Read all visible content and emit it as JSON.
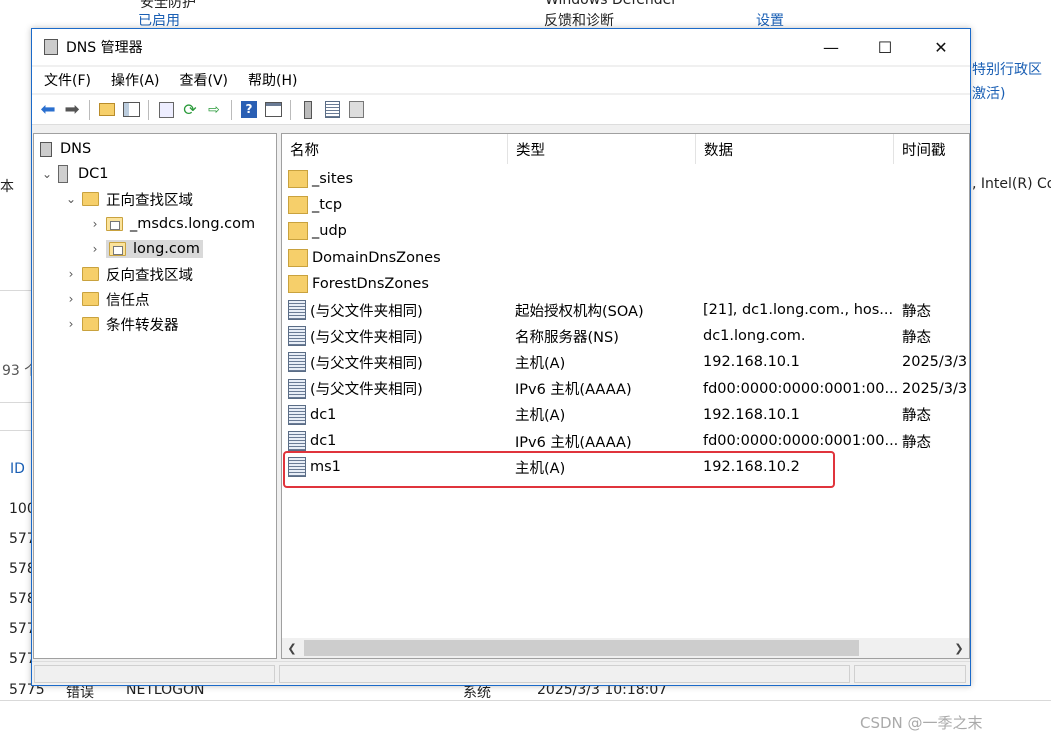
{
  "background": {
    "line1_mid": "Windows Defender",
    "line1_right": "安全防护",
    "link_enabled": "已启用",
    "feedback": "反馈和诊断",
    "settings_link": "设置",
    "region_right": "特别行政区",
    "activate_right": "激活)",
    "ben": "本",
    "cpu_right": ", Intel(R) Co",
    "count93": "93 个",
    "id_header": "ID",
    "ids": [
      "100",
      "577",
      "578",
      "578",
      "577",
      "577"
    ],
    "bottom_row": {
      "id": "5775",
      "level": "错误",
      "source": "NETLOGON",
      "category": "系统",
      "time": "2025/3/3 10:18:07"
    }
  },
  "window": {
    "title": "DNS 管理器",
    "buttons": {
      "minimize": "—",
      "maximize": "☐",
      "close": "✕"
    }
  },
  "menu": [
    "文件(F)",
    "操作(A)",
    "查看(V)",
    "帮助(H)"
  ],
  "tree": {
    "root": "DNS",
    "server": "DC1",
    "forward_zones": "正向查找区域",
    "msdcs": "_msdcs.long.com",
    "long": "long.com",
    "reverse_zones": "反向查找区域",
    "trust_points": "信任点",
    "forwarders": "条件转发器"
  },
  "list": {
    "columns": [
      "名称",
      "类型",
      "数据",
      "时间戳"
    ],
    "rows": [
      {
        "icon": "folder",
        "name": "_sites",
        "type": "",
        "data": "",
        "ts": ""
      },
      {
        "icon": "folder",
        "name": "_tcp",
        "type": "",
        "data": "",
        "ts": ""
      },
      {
        "icon": "folder",
        "name": "_udp",
        "type": "",
        "data": "",
        "ts": ""
      },
      {
        "icon": "folder",
        "name": "DomainDnsZones",
        "type": "",
        "data": "",
        "ts": ""
      },
      {
        "icon": "folder",
        "name": "ForestDnsZones",
        "type": "",
        "data": "",
        "ts": ""
      },
      {
        "icon": "record",
        "name": "(与父文件夹相同)",
        "type": "起始授权机构(SOA)",
        "data": "[21], dc1.long.com., hos...",
        "ts": "静态"
      },
      {
        "icon": "record",
        "name": "(与父文件夹相同)",
        "type": "名称服务器(NS)",
        "data": "dc1.long.com.",
        "ts": "静态"
      },
      {
        "icon": "record",
        "name": "(与父文件夹相同)",
        "type": "主机(A)",
        "data": "192.168.10.1",
        "ts": "2025/3/3"
      },
      {
        "icon": "record",
        "name": "(与父文件夹相同)",
        "type": "IPv6 主机(AAAA)",
        "data": "fd00:0000:0000:0001:00...",
        "ts": "2025/3/3"
      },
      {
        "icon": "record",
        "name": "dc1",
        "type": "主机(A)",
        "data": "192.168.10.1",
        "ts": "静态"
      },
      {
        "icon": "record",
        "name": "dc1",
        "type": "IPv6 主机(AAAA)",
        "data": "fd00:0000:0000:0001:00...",
        "ts": "静态"
      },
      {
        "icon": "record",
        "name": "ms1",
        "type": "主机(A)",
        "data": "192.168.10.2",
        "ts": ""
      }
    ]
  },
  "watermark": "CSDN @一季之末",
  "colors": {
    "highlight": "#e0343c",
    "window_border": "#1b6ac9"
  }
}
